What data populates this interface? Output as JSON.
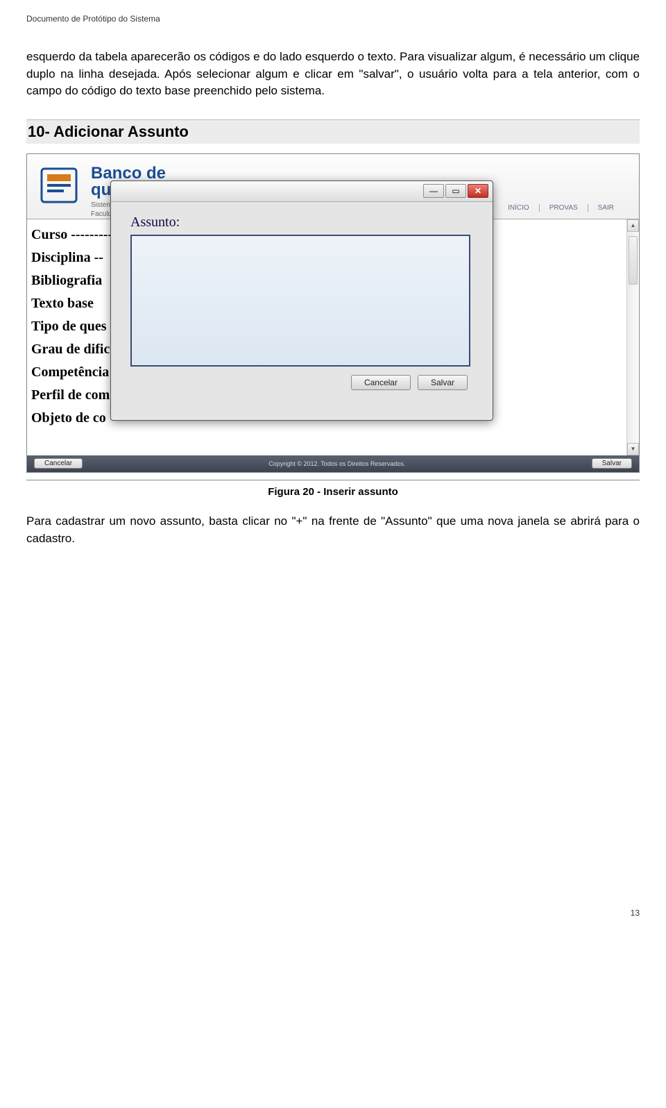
{
  "doc": {
    "header": "Documento de Protótipo do Sistema",
    "paragraph1": "esquerdo da tabela aparecerão os códigos e do lado esquerdo o texto. Para visualizar algum, é necessário um clique duplo na linha desejada. Após selecionar algum e clicar em \"salvar\", o usuário volta para a tela anterior, com o campo do código do texto base preenchido pelo sistema.",
    "section_heading": "10- Adicionar Assunto",
    "figure_caption": "Figura 20 - Inserir assunto",
    "paragraph2": "Para cadastrar um novo assunto, basta clicar no \"+\" na frente de \"Assunto\" que uma nova janela se abrirá para o cadastro.",
    "page_number": "13"
  },
  "app": {
    "brand_line1": "Banco de",
    "brand_line2": "questões",
    "brand_sub1": "Sistema de elaboração e",
    "brand_sub2": "Faculdade de Te",
    "nav": {
      "inicio": "INÍCIO",
      "provas": "PROVAS",
      "sair": "SAIR"
    },
    "form_labels": [
      "Curso ---------",
      "Disciplina --",
      "Bibliografia",
      "Texto base",
      "Tipo de ques",
      "Grau de dific",
      "Competência",
      "Perfil de com",
      "Objeto de co"
    ],
    "bottom": {
      "cancel": "Cancelar",
      "copyright": "Copyright © 2012. Todos os Direitos Reservados.",
      "save": "Salvar"
    }
  },
  "modal": {
    "label": "Assunto:",
    "value": "",
    "cancel": "Cancelar",
    "save": "Salvar",
    "minimize": "—",
    "maximize": "▭",
    "close": "✕"
  }
}
